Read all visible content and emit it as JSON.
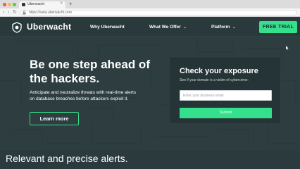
{
  "browser": {
    "tab_title": "Uberwacht",
    "tab_close": "×",
    "new_tab": "+",
    "url": "https://www.uberwacht.com",
    "back": "‹",
    "forward": "›",
    "reload": "↻",
    "lock_icon": "🔒"
  },
  "header": {
    "logo_text": "Uberwacht",
    "menu": [
      {
        "label": "Why Uberwacht",
        "has_dropdown": false
      },
      {
        "label": "What We Offer",
        "has_dropdown": true
      },
      {
        "label": "Platform",
        "has_dropdown": true
      }
    ],
    "chevron": "⌄",
    "cta_label": "FREE TRIAL"
  },
  "hero": {
    "headline_line1": "Be one step ahead of",
    "headline_line2": "the hackers.",
    "subtext_line1": "Anticipate and neutralize threats with real-time alerts",
    "subtext_line2": "on database breaches  before attackers exploit it.",
    "learn_more_label": "Learn more"
  },
  "exposure_card": {
    "title": "Check your exposure",
    "subtitle": "See if your domain is a victim of cybercrime:",
    "email_placeholder": "Enter your business email",
    "submit_label": "Submit"
  },
  "alerts": {
    "title": "Relevant and precise alerts."
  },
  "colors": {
    "accent": "#35e08c",
    "header_bg": "#2a3a3c",
    "hero_bg": "#2d3d40",
    "card_bg": "#253436"
  }
}
